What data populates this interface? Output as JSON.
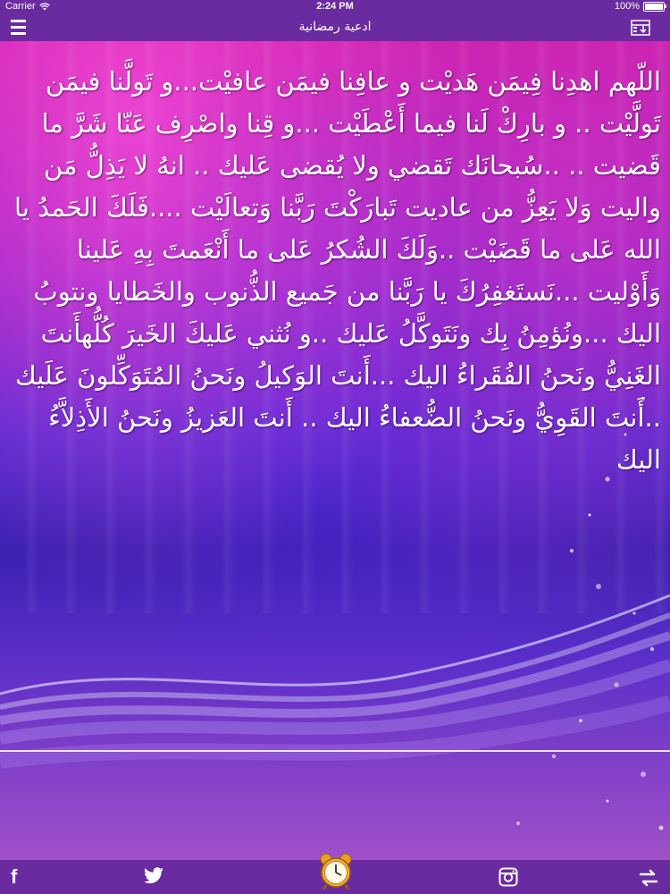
{
  "status_bar": {
    "carrier": "Carrier",
    "time": "2:24 PM",
    "battery": "100%"
  },
  "nav": {
    "title": "ادعية رمضانية"
  },
  "prayer": {
    "text": "اللّهم اهدِنا فِيمَن هَديْت و عافِنا فيمَن عافيْت...و تَولَّنا فيمَن تَولَّيْت .. و بارِكْ لَنا فيما أَعْطَيْت ...و قِنا واصْرِف عَنّا شَرَّ ما قَضيت .. ..سُبحانَك تَقضي ولا يُقضى عَليك .. انهُ لا يَذِلُّ مَن واليت وَلا يَعِزُّ من عاديت تَبارَكْتَ رَبَّنا وَتعالَيْت ....فَلَكَ الحَمدُ يا الله عَلى ما قَضَيْت ..وَلَكَ الشُكرُ عَلى ما أَنْعَمتَ بِهِ عَلينا وَأَوْليت ...نَستَغفِرُكَ يا رَبَّنا من جَميع الذُّنوب والخَطايا ونتوبُ اليك ...ونُؤمِنُ بِك ونَتَوكَّلُ عَليك ..و نُثني عَليكَ الخَيرَ كُلُّهأَنتَ الغَنِيُّ ونَحنُ الفُقَراءُ اليك ...أَنتَ الوَكيلُ ونَحنُ المُتَوَكِّلونَ عَلَيك ..أَنتَ القَوِيُّ ونَحنُ الضُّعفاءُ اليك .. أَنتَ العَزيزُ ونَحنُ الأَذِلاَّءُ اليك"
  },
  "icons": {
    "menu": "menu-icon",
    "download": "download-icon",
    "facebook": "facebook-icon",
    "twitter": "twitter-icon",
    "alarm": "alarm-clock-icon",
    "instagram": "instagram-icon",
    "share": "share-icon"
  },
  "tab_bar": {
    "facebook_glyph": "f"
  },
  "colors": {
    "bar": "#6a2aa0",
    "text": "#ffffff",
    "alarm": "#e8a020"
  }
}
